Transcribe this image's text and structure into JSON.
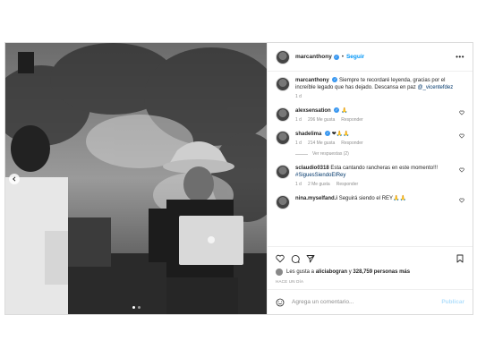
{
  "post": {
    "username": "marcanthony",
    "follow_label": "Seguir",
    "separator": "•",
    "more_label": "•••",
    "caption": {
      "username": "marcanthony",
      "text": "Siempre te recordaré leyenda, gracias por el increíble legado que has dejado. Descansa en paz",
      "mention": "@_vicentefdez",
      "time": "1 d"
    },
    "carousel": {
      "slides": 2,
      "active": 1
    }
  },
  "comments": [
    {
      "username": "alexsensation",
      "text": "🙏",
      "time": "1 d",
      "likes": "206 Me gusta",
      "reply": "Responder"
    },
    {
      "username": "shadelima",
      "text": "❤🙏🙏",
      "time": "1 d",
      "likes": "214 Me gusta",
      "reply": "Responder",
      "view_replies": "Ver respuestas (2)"
    },
    {
      "username": "sclaudio0318",
      "text": "Esta cantando rancheras en este momento!!!",
      "hashtag": "#SiguesSiendoElRey",
      "time": "1 d",
      "likes": "2 Me gusta",
      "reply": "Responder"
    },
    {
      "username": "nina.myselfand.i",
      "text": "Seguirá siendo el REY🙏🙏",
      "time": "",
      "likes": "",
      "reply": ""
    }
  ],
  "actions": {
    "icons": [
      "heart-icon",
      "comment-icon",
      "share-icon",
      "bookmark-icon"
    ]
  },
  "likes": {
    "prefix": "Les gusta a",
    "user": "aliciabogran",
    "middle": "y",
    "count": "328,759 personas más"
  },
  "date": "HACE UN DÍA",
  "add_comment": {
    "placeholder": "Agrega un comentario...",
    "publish": "Publicar"
  },
  "colors": {
    "accent": "#0095f6",
    "verified": "#3897f0",
    "muted": "#8e8e8e"
  }
}
